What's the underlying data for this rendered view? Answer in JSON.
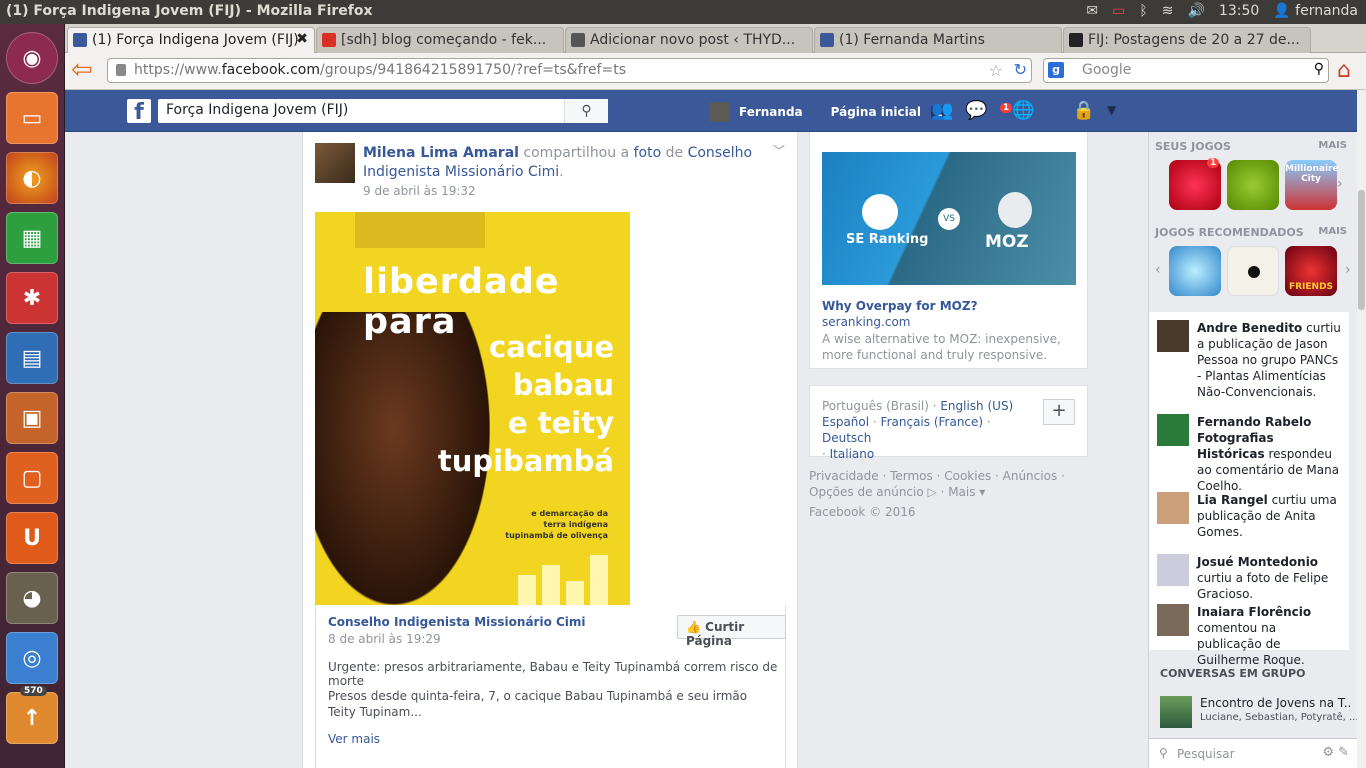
{
  "system": {
    "window_title": "(1) Força Indigena Jovem (FIJ) - Mozilla Firefox",
    "time": "13:50",
    "user": "fernanda"
  },
  "launcher": {
    "update_badge": "570"
  },
  "tabs": [
    {
      "label": "(1) Força Indigena Jovem (FIJ)",
      "color": "#3b5998"
    },
    {
      "label": "[sdh] blog começando - fek...",
      "color": "#d93025"
    },
    {
      "label": "Adicionar novo post ‹ THYD...",
      "color": "#555555"
    },
    {
      "label": "(1) Fernanda Martins",
      "color": "#3b5998"
    },
    {
      "label": "FIJ: Postagens de 20 a 27 de...",
      "color": "#222222"
    }
  ],
  "navbar": {
    "url_prefix": "https://www.",
    "url_domain": "facebook.com",
    "url_rest": "/groups/941864215891750/?ref=ts&fref=ts",
    "search_placeholder": "Google"
  },
  "fb": {
    "search_value": "Força Indigena Jovem (FIJ)",
    "user": "Fernanda",
    "home": "Página inicial",
    "home_count": "1",
    "msg_badge": "1"
  },
  "post": {
    "author": "Milena Lima Amaral",
    "shared": "compartilhou a",
    "foto": "foto",
    "de": "de",
    "page": "Conselho Indigenista Missionário Cimi",
    "dot": ".",
    "time": "9 de abril às 19:32",
    "poster": {
      "line1": "liberdade para",
      "line2": "cacique",
      "line3": "babau",
      "line4": "e teity",
      "line5": "tupibambá",
      "small1": "e demarcação da",
      "small2": "terra indígena",
      "small3": "tupinambá de olivença"
    },
    "share_name": "Conselho Indigenista Missionário Cimi",
    "share_date": "8 de abril às 19:29",
    "like_button": "Curtir Página",
    "text1": "Urgente: presos arbitrariamente, Babau e Teity Tupinambá correm risco de morte",
    "text2": "Presos desde quinta-feira, 7, o cacique Babau Tupinambá e seu irmão Teity Tupinam...",
    "more": "Ver mais"
  },
  "ad": {
    "img_left": "SE Ranking",
    "img_vs": "VS",
    "img_right": "MOZ",
    "title": "Why Overpay for MOZ?",
    "url": "seranking.com",
    "desc": "A wise alternative to MOZ: inexpensive, more functional and truly responsive."
  },
  "languages": {
    "current": "Português (Brasil)",
    "sep": " · ",
    "l1": "English (US)",
    "l2": "Español",
    "l3": "Français (France)",
    "l4": "Deutsch",
    "l5": "Italiano"
  },
  "footer": {
    "links": "Privacidade · Termos · Cookies · Anúncios · Opções de anúncio ▷ · Mais ▾",
    "copyright": "Facebook © 2016"
  },
  "rail": {
    "my_games": "SEUS JOGOS",
    "more": "MAIS",
    "recommended": "JOGOS RECOMENDADOS",
    "game_badge": "1",
    "millionaire": "Millionaire City",
    "friends": "FRIENDS"
  },
  "ticker": [
    {
      "name": "Andre Benedito",
      "text": " curtiu a publicação de Jason Pessoa no grupo PANCs - Plantas Alimentícias Não-Convencionais."
    },
    {
      "name": "Fernando Rabelo Fotografias Históricas",
      "text": " respondeu ao comentário de Mana Coelho."
    },
    {
      "name": "Lia Rangel",
      "text": " curtiu uma publicação de Anita Gomes."
    },
    {
      "name": "Josué Montedonio",
      "text": " curtiu a foto de Felipe Gracioso."
    },
    {
      "name": "Inaiara Florêncio",
      "text": " comentou na publicação de Guilherme Roque."
    }
  ],
  "chat": {
    "group_header": "CONVERSAS EM GRUPO",
    "group_title": "Encontro de Jovens na T...",
    "group_members": "Luciane, Sebastian, Potyratê, ...",
    "search_placeholder": "Pesquisar"
  }
}
